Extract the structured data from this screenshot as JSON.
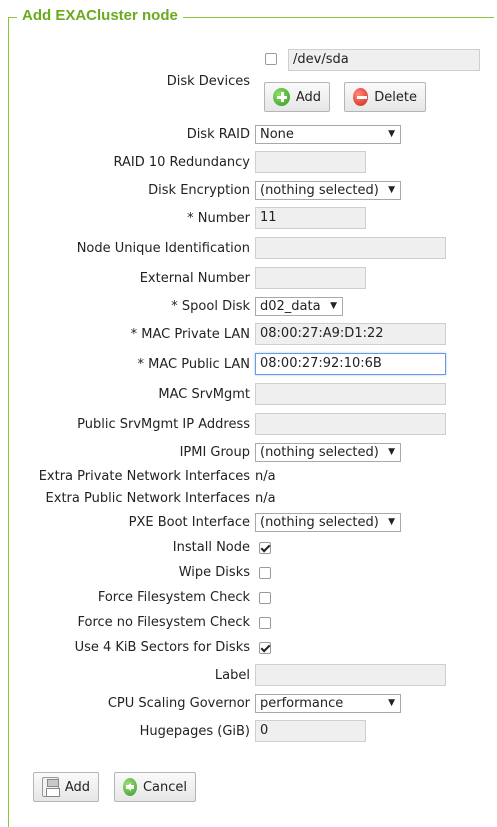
{
  "title": "Add EXACluster node",
  "disk_devices": {
    "label": "Disk Devices",
    "value": "/dev/sda",
    "checked": false,
    "add_label": "Add",
    "delete_label": "Delete"
  },
  "fields": {
    "disk_raid": {
      "label": "Disk RAID",
      "value": "None"
    },
    "raid10": {
      "label": "RAID 10 Redundancy",
      "value": ""
    },
    "disk_encryption": {
      "label": "Disk Encryption",
      "value": "(nothing selected)"
    },
    "number": {
      "label": "* Number",
      "value": "11"
    },
    "node_uid": {
      "label": "Node Unique Identification",
      "value": ""
    },
    "external_number": {
      "label": "External Number",
      "value": ""
    },
    "spool_disk": {
      "label": "* Spool Disk",
      "value": "d02_data"
    },
    "mac_private": {
      "label": "* MAC Private LAN",
      "value": "08:00:27:A9:D1:22"
    },
    "mac_public": {
      "label": "* MAC Public LAN",
      "value": "08:00:27:92:10:6B"
    },
    "mac_srvmgmt": {
      "label": "MAC SrvMgmt",
      "value": ""
    },
    "public_srvmgmt_ip": {
      "label": "Public SrvMgmt IP Address",
      "value": ""
    },
    "ipmi_group": {
      "label": "IPMI Group",
      "value": "(nothing selected)"
    },
    "extra_private": {
      "label": "Extra Private Network Interfaces",
      "value": "n/a"
    },
    "extra_public": {
      "label": "Extra Public Network Interfaces",
      "value": "n/a"
    },
    "pxe_boot": {
      "label": "PXE Boot Interface",
      "value": "(nothing selected)"
    },
    "install_node": {
      "label": "Install Node",
      "checked": true
    },
    "wipe_disks": {
      "label": "Wipe Disks",
      "checked": false
    },
    "force_fs_check": {
      "label": "Force Filesystem Check",
      "checked": false
    },
    "force_no_fs_check": {
      "label": "Force no Filesystem Check",
      "checked": false
    },
    "use_4k_sectors": {
      "label": "Use 4 KiB Sectors for Disks",
      "checked": true
    },
    "label": {
      "label": "Label",
      "value": ""
    },
    "cpu_governor": {
      "label": "CPU Scaling Governor",
      "value": "performance"
    },
    "hugepages": {
      "label": "Hugepages (GiB)",
      "value": "0"
    }
  },
  "buttons": {
    "add": "Add",
    "cancel": "Cancel"
  },
  "icons": {
    "add": "plus-circle-icon",
    "delete": "minus-circle-icon",
    "save": "floppy-disk-icon",
    "cancel": "back-arrow-icon"
  },
  "colors": {
    "accent": "#6aab1e",
    "border": "#8cc63f"
  }
}
